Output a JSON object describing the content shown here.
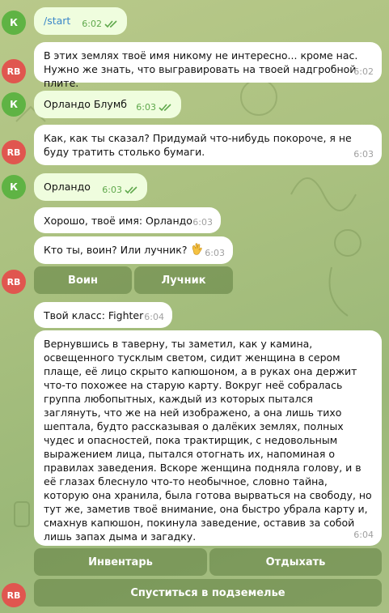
{
  "messages": [
    {
      "id": "m1",
      "avatar": "К",
      "text": "/start",
      "time": "6:02",
      "read": true
    },
    {
      "id": "m2",
      "avatar": "RB",
      "text": "В этих землях твоё имя никому не интересно... кроме нас. Нужно же знать, что выгравировать на твоей надгробной плите.",
      "time": "6:02"
    },
    {
      "id": "m3",
      "avatar": "К",
      "text": "Орландо Блумб",
      "time": "6:03",
      "read": true
    },
    {
      "id": "m4",
      "avatar": "RB",
      "text": "Как, как ты сказал? Придумай что-нибудь покороче, я не буду тратить столько бумаги.",
      "time": "6:03"
    },
    {
      "id": "m5",
      "avatar": "К",
      "text": "Орландо",
      "time": "6:03",
      "read": true
    },
    {
      "id": "m6",
      "text": "Хорошо, твоё имя: Орландо",
      "time": "6:03"
    },
    {
      "id": "m7",
      "text": "Кто ты, воин? Или лучник?",
      "emoji": "waving-hand-icon",
      "time": "6:03"
    },
    {
      "id": "m8",
      "text": "Твой класс: Fighter",
      "time": "6:04"
    },
    {
      "id": "m9",
      "avatar": "RB",
      "text": "Вернувшись в таверну, ты заметил, как у камина, освещенного тусклым светом, сидит женщина в сером плаще, её лицо скрыто капюшоном, а в руках она держит что-то похожее на старую карту. Вокруг неё собралась группа любопытных, каждый из которых пытался заглянуть, что же на ней изображено, а она лишь тихо шептала, будто рассказывая о далёких землях, полных чудес и опасностей, пока трактирщик, с недовольным выражением лица, пытался отогнать их, напоминая о правилах заведения. Вскоре женщина подняла голову, и в её глазах блеснуло что-то необычное, словно тайна, которую она хранила, была готова вырваться на свободу, но тут же, заметив твоё внимание, она быстро убрала карту и, смахнув капюшон, покинула заведение, оставив за собой лишь запах дыма и загадку.",
      "time": "6:04"
    }
  ],
  "keyboards": {
    "class_choice": {
      "warrior": "Воин",
      "archer": "Лучник"
    },
    "main_menu": {
      "inventory": "Инвентарь",
      "rest": "Отдыхать",
      "dungeon": "Спуститься в подземелье"
    }
  },
  "colors": {
    "outgoing": "#effdde",
    "incoming": "#ffffff",
    "user_avatar": "#5fb344",
    "bot_avatar": "#e0564f",
    "accent": "#5fa84c"
  }
}
